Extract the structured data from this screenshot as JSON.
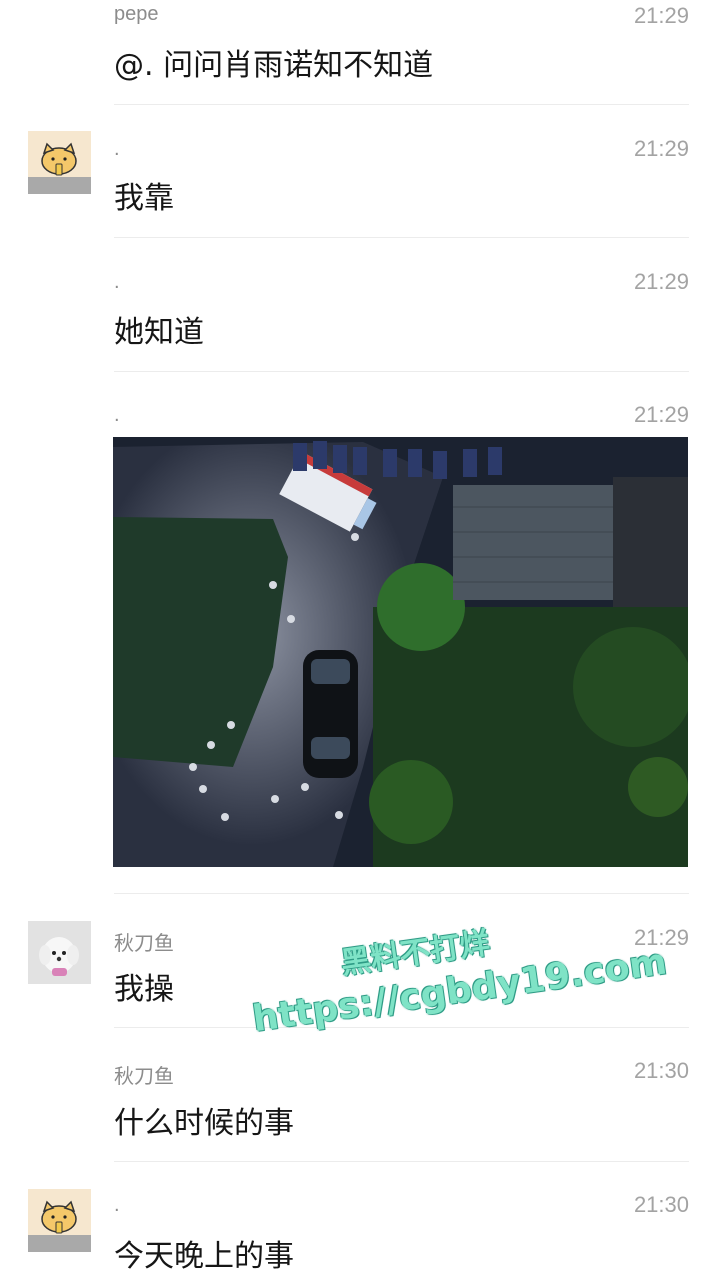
{
  "messages": [
    {
      "sender": "pepe",
      "time": "21:29",
      "text": "@. 问问肖雨诺知不知道"
    },
    {
      "sender": ".",
      "time": "21:29",
      "text": "我靠"
    },
    {
      "sender": ".",
      "time": "21:29",
      "text": "她知道"
    },
    {
      "sender": ".",
      "time": "21:29",
      "text": ""
    },
    {
      "sender": "秋刀鱼",
      "time": "21:29",
      "text": "我操"
    },
    {
      "sender": "秋刀鱼",
      "time": "21:30",
      "text": "什么时候的事"
    },
    {
      "sender": ".",
      "time": "21:30",
      "text": "今天晚上的事"
    }
  ],
  "watermark": {
    "line1": "黑料不打烊",
    "line2": "https://cgbdy19.com"
  },
  "icons": {
    "cat_avatar": "cat-avatar-icon",
    "dog_avatar": "dog-avatar-icon"
  },
  "colors": {
    "timestamp": "#a3a3a3",
    "sender": "#8c8c8c",
    "divider": "#ececec",
    "watermark": "#7fe3c6"
  }
}
